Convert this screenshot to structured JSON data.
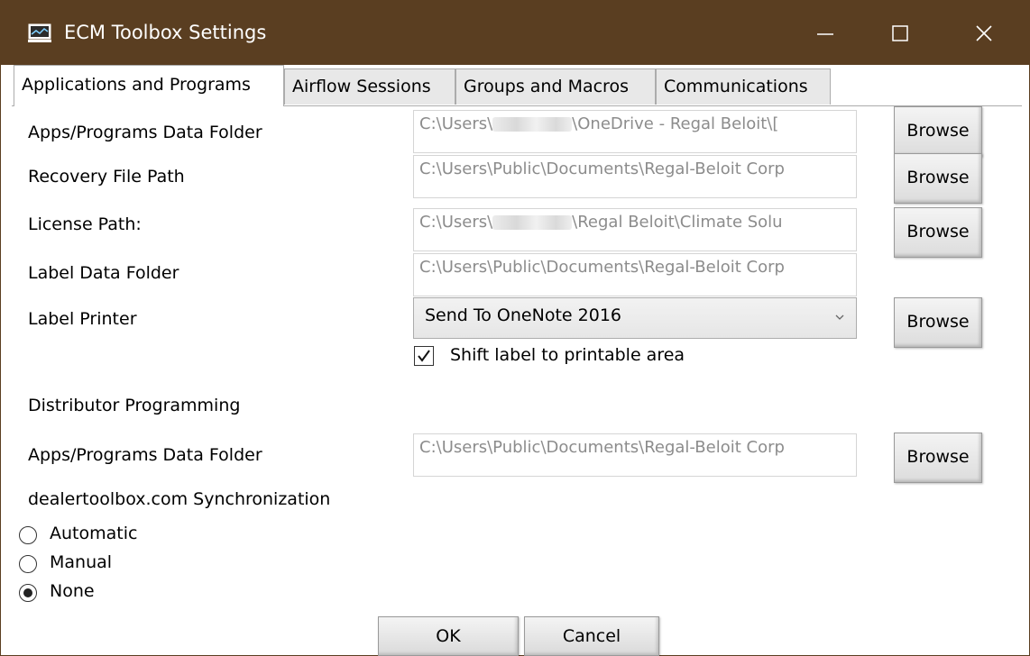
{
  "window": {
    "title": "ECM Toolbox Settings",
    "colors": {
      "titlebar": "#5a3e21",
      "titlebar_text": "#ffffff"
    },
    "controls": {
      "minimize_icon": "minimize-icon",
      "maximize_icon": "maximize-icon",
      "close_icon": "close-icon"
    }
  },
  "tabs": [
    {
      "label": "Applications and Programs",
      "active": true
    },
    {
      "label": "Airflow Sessions",
      "active": false
    },
    {
      "label": "Groups and Macros",
      "active": false
    },
    {
      "label": "Communications",
      "active": false
    }
  ],
  "settings": {
    "apps_data_folder": {
      "label": "Apps/Programs Data Folder",
      "value_prefix": "C:\\Users\\",
      "value_suffix": "\\OneDrive - Regal Beloit\\[",
      "browse_label": "Browse"
    },
    "recovery_path": {
      "label": "Recovery File Path",
      "value": "C:\\Users\\Public\\Documents\\Regal-Beloit Corp",
      "browse_label": "Browse"
    },
    "license_path": {
      "label": "License Path:",
      "value_prefix": "C:\\Users\\",
      "value_suffix": "\\Regal Beloit\\Climate Solu",
      "browse_label": "Browse"
    },
    "label_data_folder": {
      "label": "Label Data Folder",
      "value": "C:\\Users\\Public\\Documents\\Regal-Beloit Corp"
    },
    "label_printer": {
      "label": "Label Printer",
      "selected": "Send To OneNote 2016",
      "browse_label": "Browse"
    },
    "shift_label": {
      "label": "Shift label to printable area",
      "checked": true
    }
  },
  "distributor": {
    "heading": "Distributor Programming",
    "apps_data_folder": {
      "label": "Apps/Programs Data Folder",
      "value": "C:\\Users\\Public\\Documents\\Regal-Beloit Corp",
      "browse_label": "Browse"
    },
    "sync": {
      "label": "dealertoolbox.com Synchronization",
      "options": [
        {
          "label": "Automatic",
          "selected": false
        },
        {
          "label": "Manual",
          "selected": false
        },
        {
          "label": "None",
          "selected": true
        }
      ]
    }
  },
  "footer": {
    "ok_label": "OK",
    "cancel_label": "Cancel"
  }
}
